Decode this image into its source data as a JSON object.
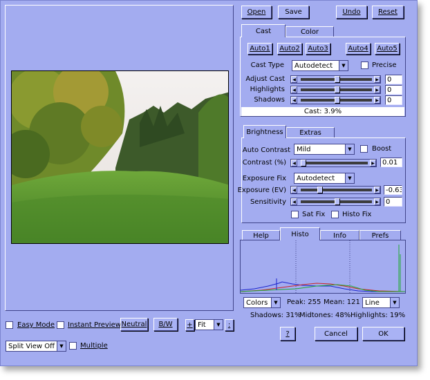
{
  "top_buttons": {
    "open": "Open",
    "save": "Save",
    "undo": "Undo",
    "reset": "Reset"
  },
  "cast": {
    "tabs": [
      "Cast",
      "Color"
    ],
    "auto_buttons": [
      "Auto1",
      "Auto2",
      "Auto3",
      "Auto4",
      "Auto5"
    ],
    "cast_type_label": "Cast Type",
    "cast_type_value": "Autodetect",
    "precise_label": "Precise",
    "adjust_cast_label": "Adjust Cast",
    "adjust_cast_value": "0",
    "highlights_label": "Highlights",
    "highlights_value": "0",
    "shadows_label": "Shadows",
    "shadows_value": "0",
    "status": "Cast: 3.9%"
  },
  "brightness": {
    "tabs": [
      "Brightness",
      "Extras"
    ],
    "auto_contrast_label": "Auto Contrast",
    "auto_contrast_value": "Mild",
    "boost_label": "Boost",
    "contrast_label": "Contrast (%)",
    "contrast_value": "0.01",
    "exposure_fix_label": "Exposure Fix",
    "exposure_fix_value": "Autodetect",
    "exposure_label": "Exposure (EV)",
    "exposure_value": "-0.63",
    "sensitivity_label": "Sensitivity",
    "sensitivity_value": "0",
    "sat_fix_label": "Sat Fix",
    "histo_fix_label": "Histo Fix"
  },
  "histo": {
    "tabs": [
      "Help",
      "Histo",
      "Info",
      "Prefs"
    ],
    "channel": "Colors",
    "peak": "Peak: 255",
    "mean": "Mean: 121",
    "mode": "Line",
    "shadows": "Shadows: 31%",
    "midtones": "Midtones: 48%",
    "highlights": "Highlights: 19%"
  },
  "dialog": {
    "help": "?",
    "cancel": "Cancel",
    "ok": "OK"
  },
  "bottom": {
    "easy_mode": "Easy Mode",
    "instant_preview": "Instant Preview",
    "neutral": "Neutral",
    "bw": "B/W",
    "zoom_plus": "+",
    "zoom_value": "Fit",
    "zoom_minus": ":",
    "split_view": "Split View Off",
    "multiple": "Multiple"
  },
  "colors": {
    "accent": "#a3acf0",
    "button": "#a9b2f4",
    "dark": "#40448a"
  }
}
